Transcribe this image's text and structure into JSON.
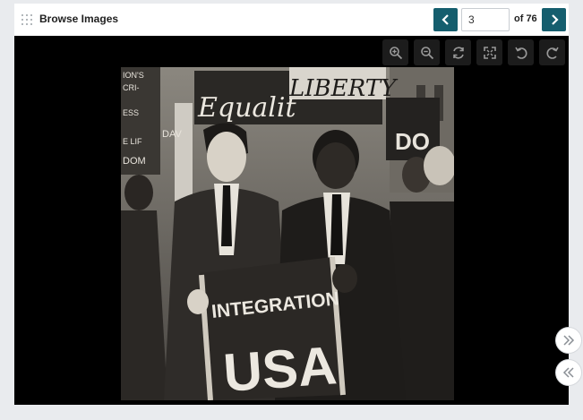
{
  "header": {
    "title": "Browse Images",
    "page_current": "3",
    "page_of_label": "of 76",
    "prev_icon": "chevron-left-icon",
    "next_icon": "chevron-right-icon"
  },
  "toolbar": {
    "tools": [
      "zoom-in-icon",
      "zoom-out-icon",
      "reset-view-icon",
      "fullscreen-icon",
      "rotate-left-icon",
      "rotate-right-icon"
    ]
  },
  "image": {
    "sign_left_top": "ION'S",
    "sign_left_2": "CRI-",
    "sign_left_3": "ESS",
    "sign_left_4": "DAV",
    "sign_left_5": "E LIF",
    "sign_left_6": "DOM",
    "sign_equality": "Equalit",
    "sign_liberty": "LIBERTY",
    "sign_right": "DO",
    "banner_line1": "INTEGRATION",
    "banner_line2": "USA"
  },
  "side_buttons": {
    "expand_icon": "double-chevron-right-icon",
    "collapse_icon": "double-chevron-left-icon"
  },
  "colors": {
    "accent": "#155e6e",
    "viewer_bg": "#000000",
    "page_bg": "#e9ebee"
  }
}
